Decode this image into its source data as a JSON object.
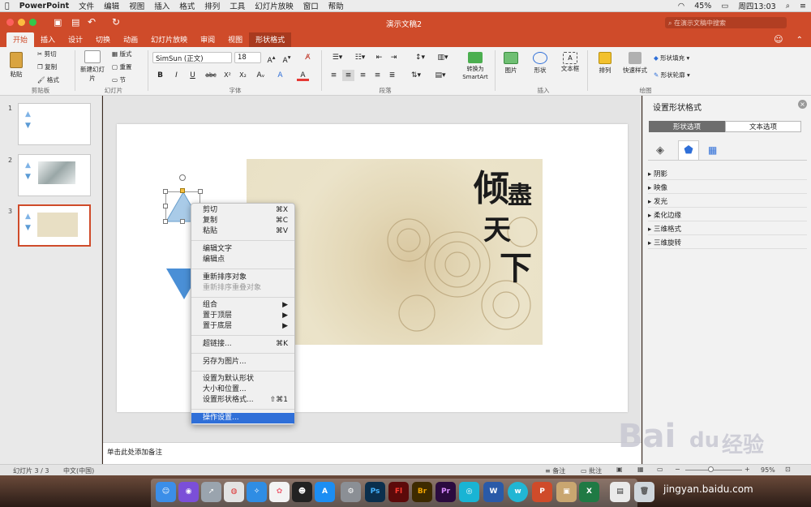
{
  "menubar": {
    "app": "PowerPoint",
    "items": [
      "文件",
      "编辑",
      "视图",
      "插入",
      "格式",
      "排列",
      "工具",
      "幻灯片放映",
      "窗口",
      "帮助"
    ],
    "battery": "45%",
    "clock": "周四13:03"
  },
  "title": {
    "doc": "演示文稿2",
    "search_placeholder": "在演示文稿中搜索"
  },
  "tabs": [
    "开始",
    "插入",
    "设计",
    "切换",
    "动画",
    "幻灯片放映",
    "审阅",
    "视图",
    "形状格式"
  ],
  "ribbon": {
    "paste": "粘贴",
    "cut": "剪切",
    "copy": "复制",
    "format": "格式",
    "grp_clipboard": "剪贴板",
    "new_slide": "新建幻灯片",
    "layout": "版式",
    "reset": "重置",
    "section": "节",
    "grp_slides": "幻灯片",
    "font_name": "SimSun (正文)",
    "font_size": "18",
    "grp_font": "字体",
    "bold": "B",
    "italic": "I",
    "underline": "U",
    "strike": "abc",
    "sup": "X²",
    "sub": "X₂",
    "grp_paragraph": "段落",
    "smartart": "转换为SmartArt",
    "picture": "图片",
    "shape": "形状",
    "textbox": "文本框",
    "grp_insert": "插入",
    "arrange": "排列",
    "quickstyle": "快速样式",
    "fill": "形状填充",
    "outline": "形状轮廓",
    "grp_drawing": "绘图"
  },
  "slides": {
    "nums": [
      "1",
      "2",
      "3"
    ]
  },
  "slide": {
    "calligraphy": [
      "倾",
      "盡",
      "天",
      "下"
    ]
  },
  "notes": "单击此处添加备注",
  "context_menu": [
    {
      "label": "剪切",
      "shortcut": "⌘X"
    },
    {
      "label": "复制",
      "shortcut": "⌘C"
    },
    {
      "label": "粘贴",
      "shortcut": "⌘V"
    },
    {
      "label": "编辑文字",
      "shortcut": ""
    },
    {
      "label": "编辑点",
      "shortcut": ""
    },
    {
      "label": "重新排序对象",
      "shortcut": ""
    },
    {
      "label": "重新排序重叠对象",
      "shortcut": ""
    },
    {
      "label": "组合",
      "shortcut": "▶"
    },
    {
      "label": "置于顶层",
      "shortcut": "▶"
    },
    {
      "label": "置于底层",
      "shortcut": "▶"
    },
    {
      "label": "超链接...",
      "shortcut": "⌘K"
    },
    {
      "label": "另存为图片...",
      "shortcut": ""
    },
    {
      "label": "设置为默认形状",
      "shortcut": ""
    },
    {
      "label": "大小和位置...",
      "shortcut": ""
    },
    {
      "label": "设置形状格式...",
      "shortcut": "⇧⌘1"
    },
    {
      "label": "操作设置...",
      "shortcut": ""
    }
  ],
  "format_pane": {
    "title": "设置形状格式",
    "tab_shape": "形状选项",
    "tab_text": "文本选项",
    "sections": [
      "阴影",
      "映像",
      "发光",
      "柔化边缘",
      "三维格式",
      "三维旋转"
    ]
  },
  "status": {
    "slide_count": "幻灯片 3 / 3",
    "language": "中文(中国)",
    "notes": "备注",
    "comments": "批注",
    "zoom": "95%"
  },
  "dock": {
    "ps": "Ps",
    "fl": "Fl",
    "br": "Br",
    "pr": "Pr",
    "w": "W",
    "p": "P",
    "x": "X"
  },
  "watermark": {
    "main": "Bai",
    "du": "du",
    "jy": "经验",
    "url": "jingyan.baidu.com"
  },
  "colors": {
    "accent": "#cf4b2a",
    "selection": "#2f6fd8"
  }
}
